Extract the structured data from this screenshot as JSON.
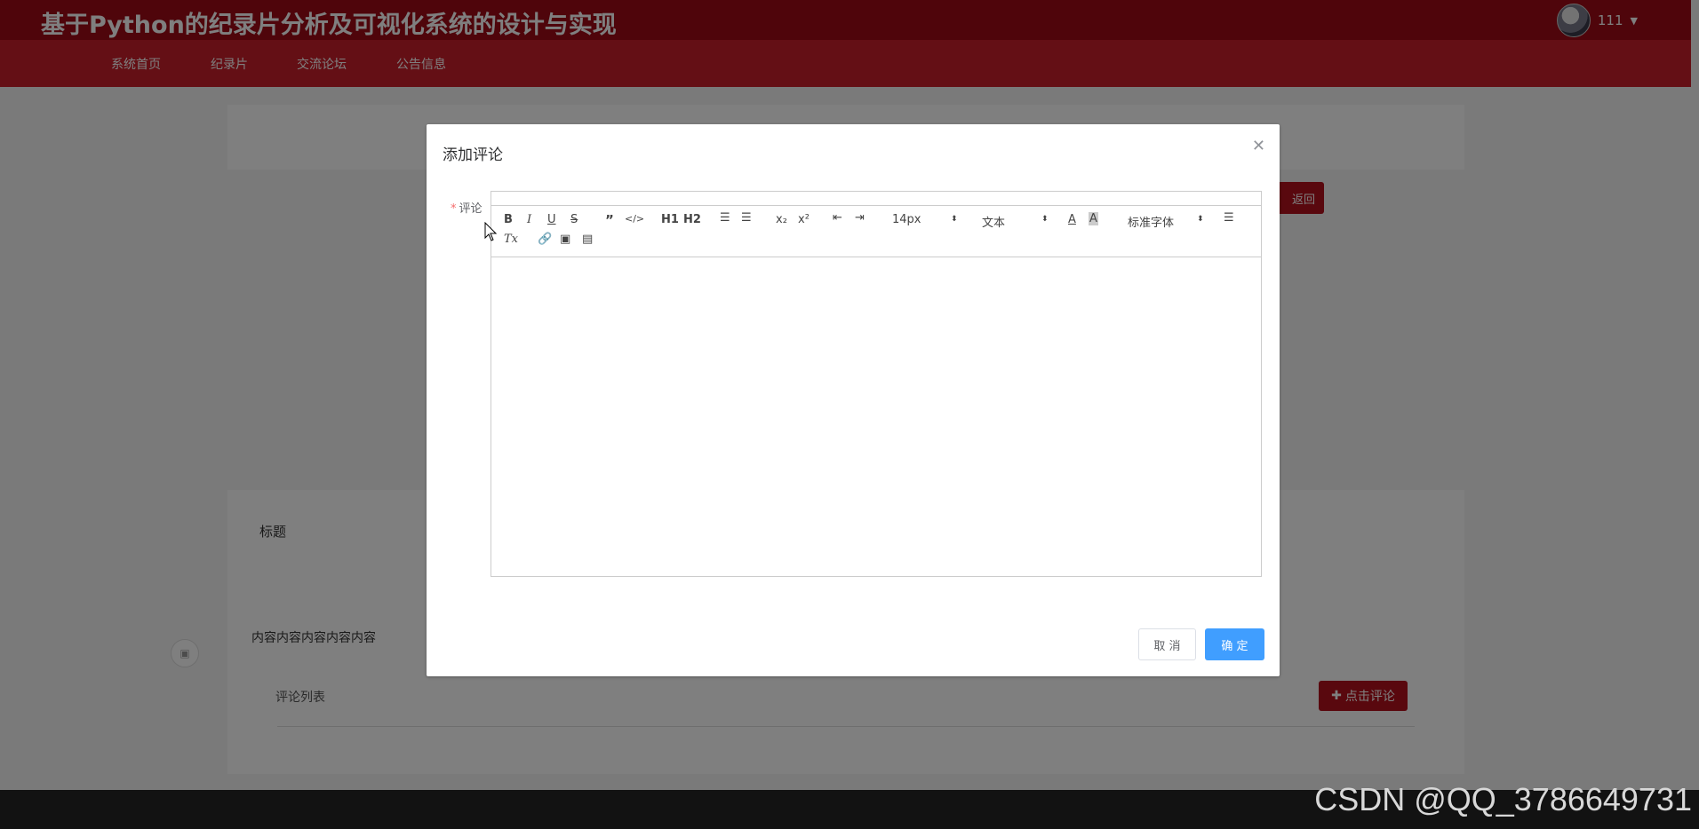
{
  "header": {
    "site_title": "基于Python的纪录片分析及可视化系统的设计与实现",
    "user_name": "111"
  },
  "nav": {
    "items": [
      {
        "label": "系统首页"
      },
      {
        "label": "纪录片"
      },
      {
        "label": "交流论坛"
      },
      {
        "label": "公告信息"
      }
    ]
  },
  "page": {
    "back_label": "返回",
    "title_label": "标题",
    "content_text": "内容内容内容内容内容",
    "comment_list_label": "评论列表",
    "add_comment_label": "点击评论"
  },
  "dialog": {
    "title": "添加评论",
    "field_label": "评论",
    "cancel_label": "取 消",
    "ok_label": "确 定",
    "toolbar": {
      "font_size": "14px",
      "header_picker": "文本",
      "font_family": "标准字体",
      "h1": "H1",
      "h2": "H2"
    }
  },
  "watermark": "CSDN @QQ_3786649731",
  "colors": {
    "header_bg": "#9e0b16",
    "nav_bg": "#c81f2b",
    "primary_btn": "#409eff"
  }
}
